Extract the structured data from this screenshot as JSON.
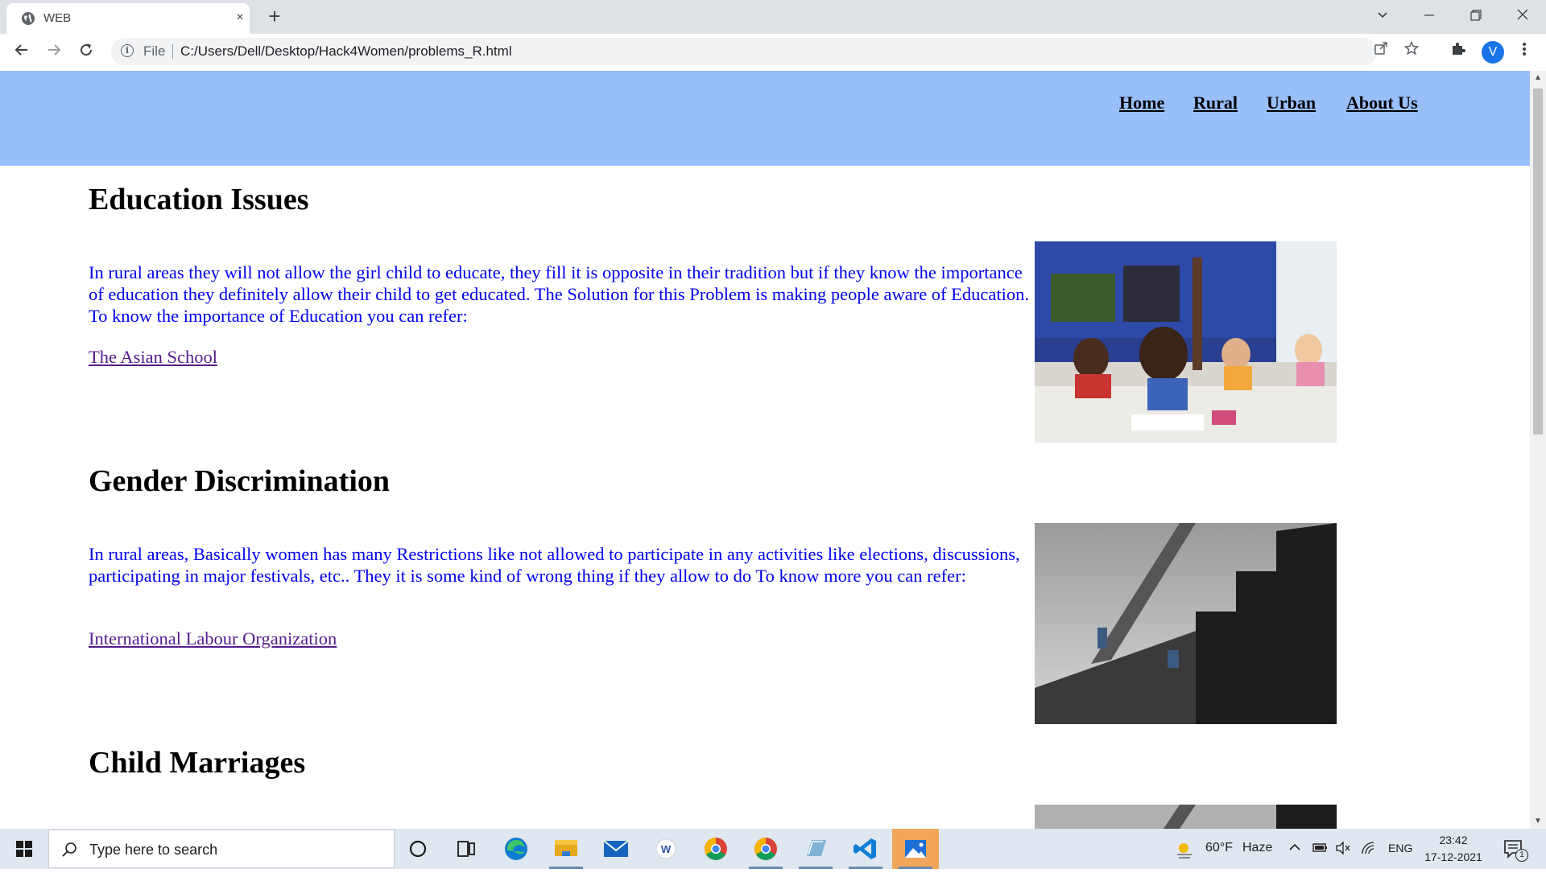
{
  "browser": {
    "tab_title": "WEB",
    "tab_close": "×",
    "new_tab": "+",
    "address_scheme": "File",
    "address_url": "C:/Users/Dell/Desktop/Hack4Women/problems_R.html",
    "profile_initial": "V",
    "icons": [
      "globe-icon",
      "back-arrow-icon",
      "forward-arrow-icon",
      "reload-icon",
      "info-icon",
      "share-icon",
      "bookmark-star-icon",
      "extensions-icon",
      "kebab-menu-icon",
      "tab-search-icon",
      "minimize-icon",
      "restore-icon",
      "close-window-icon"
    ]
  },
  "page": {
    "header_bg": "#99bffb",
    "nav": [
      "Home",
      "Rural",
      "Urban",
      "About Us"
    ],
    "sections": [
      {
        "title": "Education Issues",
        "text": "In rural areas they will not allow the girl child to educate, they fill it is opposite in their tradition but if they know the importance of education they definitely allow their child to get educated. The Solution for this Problem is making people aware of Education. To know the importance of Education you can refer:",
        "link": "The Asian School",
        "image": "classroom-photo"
      },
      {
        "title": "Gender Discrimination",
        "text": "In rural areas, Basically women has many Restrictions like not allowed to participate in any activities like elections, discussions, participating in major festivals, etc.. They it is some kind of wrong thing if they allow to do To know more you can refer:",
        "link": "International Labour Organization",
        "image": "staircase-photo"
      },
      {
        "title": "Child Marriages",
        "image": "staircase-photo"
      }
    ]
  },
  "taskbar": {
    "search_placeholder": "Type here to search",
    "apps": [
      "cortana-icon",
      "task-view-icon",
      "edge-icon",
      "file-explorer-icon",
      "mail-icon",
      "word-pad-icon",
      "chrome-icon",
      "chrome-profile-icon",
      "notepad-icon",
      "vscode-icon",
      "photos-icon"
    ],
    "weather_temp": "60°F",
    "weather_desc": "Haze",
    "language": "ENG",
    "time": "23:42",
    "date": "17-12-2021",
    "notification_count": "1"
  }
}
